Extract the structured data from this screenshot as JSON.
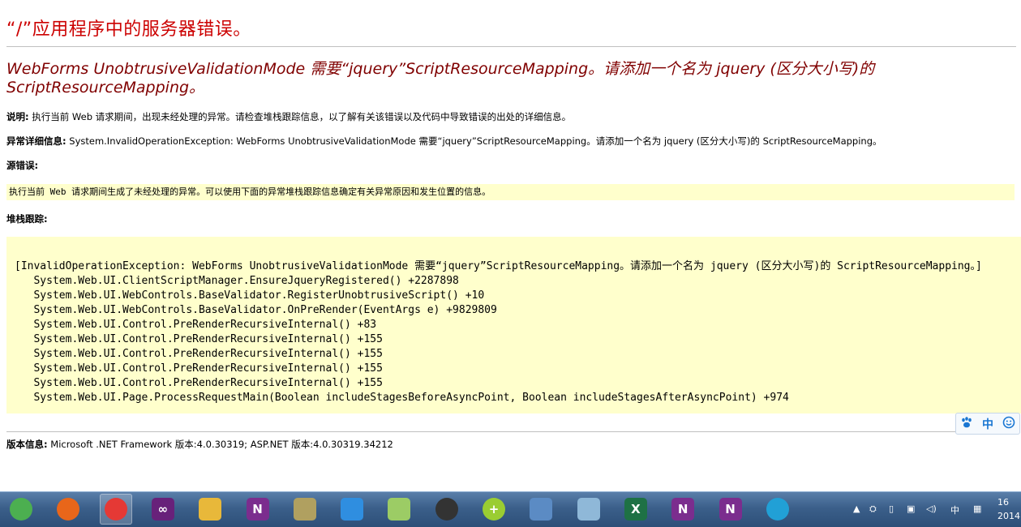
{
  "page": {
    "title": "“/”应用程序中的服务器错误。",
    "error_message": "WebForms UnobtrusiveValidationMode 需要“jquery”ScriptResourceMapping。请添加一个名为 jquery (区分大小写)的 ScriptResourceMapping。",
    "description_label": "说明:",
    "description_text": "执行当前 Web 请求期间，出现未经处理的异常。请检查堆栈跟踪信息，以了解有关该错误以及代码中导致错误的出处的详细信息。",
    "exception_label": "异常详细信息:",
    "exception_text": "System.InvalidOperationException: WebForms UnobtrusiveValidationMode 需要“jquery”ScriptResourceMapping。请添加一个名为 jquery (区分大小写)的 ScriptResourceMapping。",
    "source_error_label": "源错误:",
    "source_error_text": "执行当前 Web 请求期间生成了未经处理的异常。可以使用下面的异常堆栈跟踪信息确定有关异常原因和发生位置的信息。",
    "stack_trace_label": "堆栈跟踪:",
    "stack_trace": [
      "[InvalidOperationException: WebForms UnobtrusiveValidationMode 需要“jquery”ScriptResourceMapping。请添加一个名为 jquery (区分大小写)的 ScriptResourceMapping。]",
      "   System.Web.UI.ClientScriptManager.EnsureJqueryRegistered() +2287898",
      "   System.Web.UI.WebControls.BaseValidator.RegisterUnobtrusiveScript() +10",
      "   System.Web.UI.WebControls.BaseValidator.OnPreRender(EventArgs e) +9829809",
      "   System.Web.UI.Control.PreRenderRecursiveInternal() +83",
      "   System.Web.UI.Control.PreRenderRecursiveInternal() +155",
      "   System.Web.UI.Control.PreRenderRecursiveInternal() +155",
      "   System.Web.UI.Control.PreRenderRecursiveInternal() +155",
      "   System.Web.UI.Control.PreRenderRecursiveInternal() +155",
      "   System.Web.UI.Page.ProcessRequestMain(Boolean includeStagesBeforeAsyncPoint, Boolean includeStagesAfterAsyncPoint) +974"
    ],
    "version_label": "版本信息:",
    "version_text": "Microsoft .NET Framework 版本:4.0.30319; ASP.NET 版本:4.0.30319.34212"
  },
  "ime_toolbar": {
    "mode_label": "中",
    "paw_icon": "paw-icon",
    "smile_icon": "smile-icon"
  },
  "taskbar": {
    "items": [
      {
        "name": "start-orb-icon",
        "color": "#4caf50"
      },
      {
        "name": "firefox-icon",
        "color": "#e8661a"
      },
      {
        "name": "photo-pinwheel-icon",
        "color": "#e53935",
        "active": true
      },
      {
        "name": "visual-studio-icon",
        "color": "#68217a",
        "glyph": "∞"
      },
      {
        "name": "file-explorer-icon",
        "color": "#e8b83a"
      },
      {
        "name": "onenote-icon",
        "color": "#7b2d8e",
        "glyph": "N"
      },
      {
        "name": "tools-icon",
        "color": "#b0a060"
      },
      {
        "name": "pen-note-icon",
        "color": "#2f8ee0"
      },
      {
        "name": "sticky-notes-icon",
        "color": "#9ccc65"
      },
      {
        "name": "clock-icon",
        "color": "#333333"
      },
      {
        "name": "plus-app-icon",
        "color": "#9acd32",
        "glyph": "+"
      },
      {
        "name": "remote-desktop-icon",
        "color": "#5b8bc4"
      },
      {
        "name": "notepad-icon",
        "color": "#8fb8d8"
      },
      {
        "name": "excel-icon",
        "color": "#1e7145",
        "glyph": "X"
      },
      {
        "name": "onenote2-icon",
        "color": "#7b2d8e",
        "glyph": "N"
      },
      {
        "name": "onenote-clipper-icon",
        "color": "#7b2d8e",
        "glyph": "N"
      },
      {
        "name": "media-player-icon",
        "color": "#21a0d6"
      }
    ],
    "tray_ime": "中",
    "clock_time": "16",
    "clock_date": "2014"
  }
}
